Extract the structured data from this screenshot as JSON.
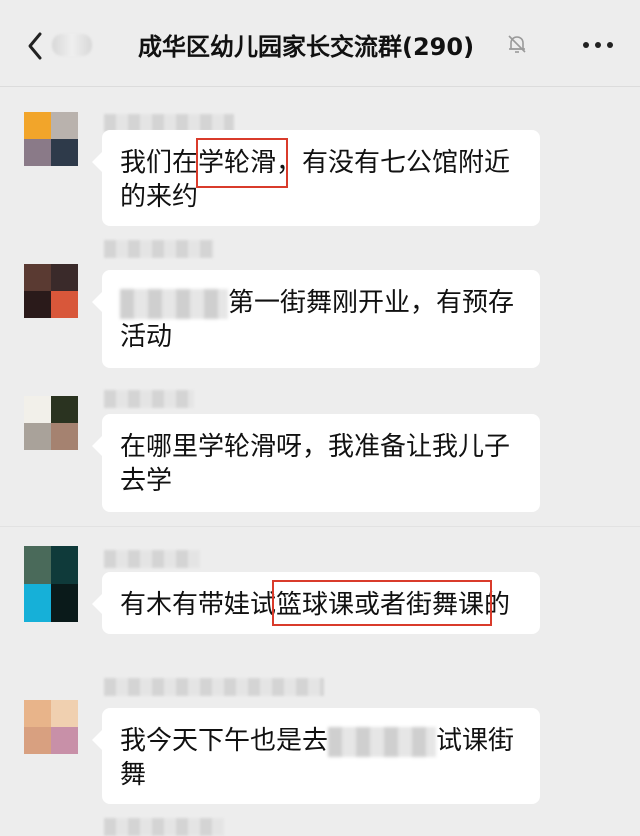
{
  "header": {
    "title": "成华区幼儿园家长交流群(290)"
  },
  "messages": [
    {
      "text": "我们在学轮滑，有没有七公馆附近的来约"
    },
    {
      "text": "第一街舞刚开业，有预存活动"
    },
    {
      "text": "在哪里学轮滑呀，我准备让我儿子去学"
    },
    {
      "text": "有木有带娃试篮球课或者街舞课的"
    },
    {
      "text_before": "我今天下午也是去",
      "text_after": "试课街舞"
    }
  ]
}
